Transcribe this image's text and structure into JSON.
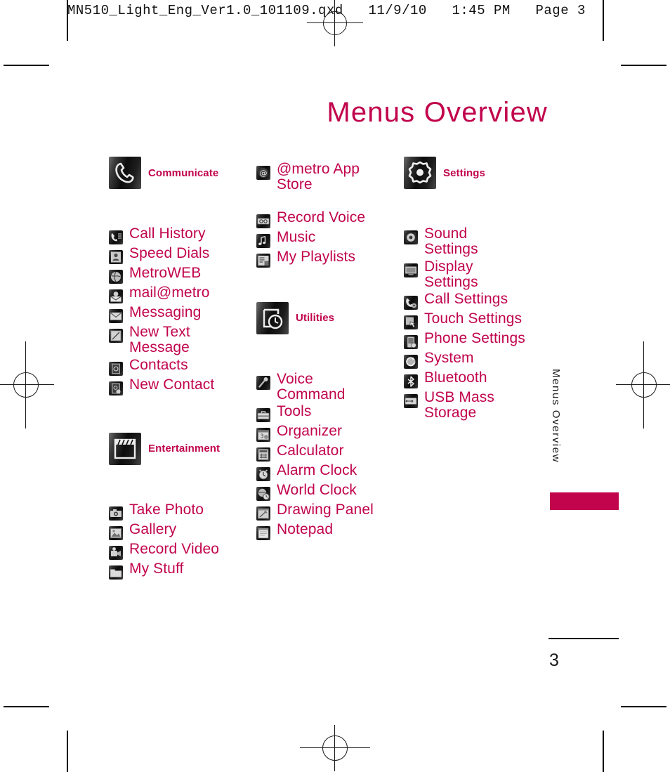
{
  "print_header": {
    "text": "MN510_Light_Eng_Ver1.0_101109.qxd   11/9/10   1:45 PM   Page 3"
  },
  "page": {
    "title": "Menus Overview",
    "side_tab_label": "Menus Overview",
    "page_number": "3",
    "accent_color": "#C1044C",
    "text_color": "#1a1a1a"
  },
  "columns": [
    {
      "id": "column-1",
      "groups": [
        {
          "id": "communicate",
          "label": "Communicate",
          "icon": "phone-handset-icon",
          "items": [
            {
              "label": "Call History",
              "icon": "call-history-icon"
            },
            {
              "label": "Speed Dials",
              "icon": "speed-dials-icon"
            },
            {
              "label": "MetroWEB",
              "icon": "globe-icon"
            },
            {
              "label": "mail@metro",
              "icon": "mail-metro-icon"
            },
            {
              "label": "Messaging",
              "icon": "envelope-icon"
            },
            {
              "label": "New Text",
              "label2": "Message",
              "icon": "new-text-message-icon"
            },
            {
              "label": "Contacts",
              "icon": "contacts-icon"
            },
            {
              "label": "New Contact",
              "icon": "new-contact-icon"
            }
          ]
        },
        {
          "id": "entertainment",
          "label": "Entertainment",
          "icon": "clapperboard-icon",
          "items": [
            {
              "label": "Take Photo",
              "icon": "camera-icon"
            },
            {
              "label": "Gallery",
              "icon": "gallery-icon"
            },
            {
              "label": "Record Video",
              "icon": "camcorder-icon"
            },
            {
              "label": "My Stuff",
              "icon": "folder-icon"
            }
          ]
        }
      ]
    },
    {
      "id": "column-2",
      "groups": [
        {
          "id": "app-store-group",
          "label": "",
          "icon": "",
          "items": [
            {
              "label": "@metro App",
              "label2": "Store",
              "icon": "at-metro-app-store-icon"
            },
            {
              "label": "Record Voice",
              "icon": "voice-recorder-icon"
            },
            {
              "label": "Music",
              "icon": "music-note-icon"
            },
            {
              "label": "My Playlists",
              "icon": "playlist-icon"
            }
          ]
        },
        {
          "id": "utilities",
          "label": "Utilities",
          "icon": "utilities-clock-icon",
          "items": [
            {
              "label": "Voice",
              "label2": "Command",
              "icon": "microphone-icon"
            },
            {
              "label": "Tools",
              "icon": "toolbox-icon"
            },
            {
              "label": "Organizer",
              "icon": "organizer-calendar-icon"
            },
            {
              "label": "Calculator",
              "icon": "calculator-icon"
            },
            {
              "label": "Alarm Clock",
              "icon": "alarm-clock-icon"
            },
            {
              "label": "World Clock",
              "icon": "world-clock-icon"
            },
            {
              "label": "Drawing Panel",
              "icon": "drawing-panel-icon"
            },
            {
              "label": "Notepad",
              "icon": "notepad-icon"
            }
          ]
        }
      ]
    },
    {
      "id": "column-3",
      "groups": [
        {
          "id": "settings",
          "label": "Settings",
          "icon": "gear-icon",
          "items": [
            {
              "label": "Sound",
              "label2": "Settings",
              "icon": "sound-settings-icon"
            },
            {
              "label": "Display",
              "label2": "Settings",
              "icon": "display-settings-icon"
            },
            {
              "label": "Call Settings",
              "icon": "call-settings-icon"
            },
            {
              "label": "Touch Settings",
              "icon": "touch-settings-icon"
            },
            {
              "label": "Phone Settings",
              "icon": "phone-settings-icon"
            },
            {
              "label": "System",
              "icon": "system-icon"
            },
            {
              "label": "Bluetooth",
              "icon": "bluetooth-icon"
            },
            {
              "label": "USB Mass",
              "label2": "Storage",
              "icon": "usb-mass-storage-icon"
            }
          ]
        }
      ]
    }
  ]
}
